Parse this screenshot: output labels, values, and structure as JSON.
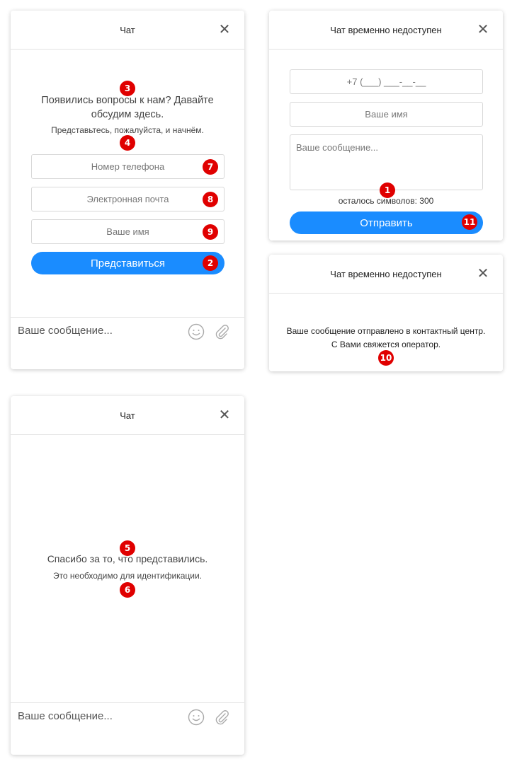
{
  "panel1": {
    "title": "Чат",
    "close": "✕",
    "question": "Появились вопросы к нам? Давайте обсудим здесь.",
    "intro": "Представьтесь, пожалуйста, и начнём.",
    "phone_placeholder": "Номер телефона",
    "email_placeholder": "Электронная почта",
    "name_placeholder": "Ваше имя",
    "submit_label": "Представиться",
    "message_placeholder": "Ваше сообщение..."
  },
  "panel2": {
    "title": "Чат временно недоступен",
    "close": "✕",
    "phone_mask": "+7 (___) ___-__-__",
    "name_placeholder": "Ваше имя",
    "message_placeholder": "Ваше сообщение...",
    "chars_left": "осталось символов: 300",
    "send_label": "Отправить"
  },
  "panel3": {
    "title": "Чат временно недоступен",
    "close": "✕",
    "line1": "Ваше сообщение отправлено в контактный центр.",
    "line2": "С Вами свяжется оператор."
  },
  "panel4": {
    "title": "Чат",
    "close": "✕",
    "thanks": "Спасибо за то, что представились.",
    "note": "Это необходимо для идентификации.",
    "message_placeholder": "Ваше сообщение..."
  },
  "badges": {
    "b1": "1",
    "b2": "2",
    "b3": "3",
    "b4": "4",
    "b5": "5",
    "b6": "6",
    "b7": "7",
    "b8": "8",
    "b9": "9",
    "b10": "10",
    "b11": "11"
  },
  "colors": {
    "accent": "#1a8cff",
    "badge": "#e00000"
  },
  "icons": [
    "close-icon",
    "smile-icon",
    "paperclip-icon"
  ]
}
